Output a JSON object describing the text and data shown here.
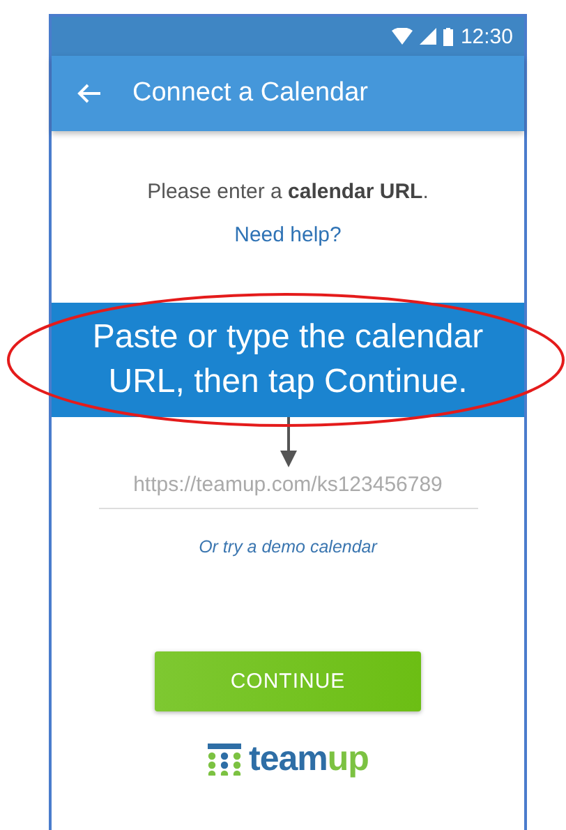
{
  "status_bar": {
    "time": "12:30"
  },
  "app_bar": {
    "title": "Connect a Calendar"
  },
  "prompt": "Please enter a **calendar URL**.",
  "help_link": "Need help?",
  "callout": "Paste or type the calendar URL, then tap Continue.",
  "url_field": {
    "placeholder": "https://teamup.com/ks123456789"
  },
  "demo_link": "Or try a demo calendar",
  "continue_button": "CONTINUE",
  "logo": {
    "primary": "team",
    "accent": "up"
  }
}
